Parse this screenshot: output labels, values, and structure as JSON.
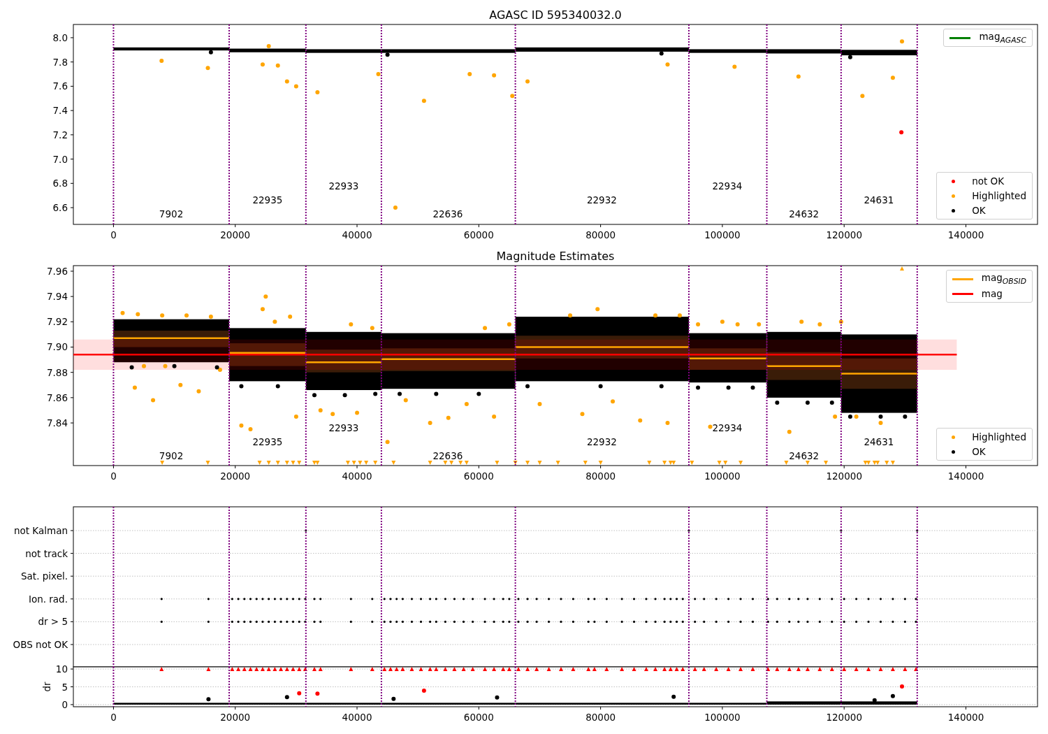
{
  "panels": [
    {
      "chart_data": {
        "type": "scatter",
        "title": "AGASC ID 595340032.0",
        "xlim": [
          -6590,
          151760
        ],
        "ylim": [
          6.462,
          8.109
        ],
        "xticks": [
          0,
          20000,
          40000,
          60000,
          80000,
          100000,
          120000,
          140000
        ],
        "yticks": [
          {
            "value": 6.6,
            "label": "6.6"
          },
          {
            "value": 6.8,
            "label": "6.8"
          },
          {
            "value": 7.0,
            "label": "7.0"
          },
          {
            "value": 7.2,
            "label": "7.2"
          },
          {
            "value": 7.4,
            "label": "7.4"
          },
          {
            "value": 7.6,
            "label": "7.6"
          },
          {
            "value": 7.8,
            "label": "7.8"
          },
          {
            "value": 8.0,
            "label": "8.0"
          }
        ],
        "series": [
          {
            "type": "scatter",
            "color": "#ff0000",
            "x": [
              129400
            ],
            "values": [
              7.22
            ]
          },
          {
            "type": "scatter",
            "color": "#ffa500",
            "x": [
              7900,
              15500,
              24500,
              25500,
              27000,
              28500,
              30000,
              33500,
              43500,
              46300,
              51000,
              58500,
              62500,
              65500,
              68000,
              91000,
              102000,
              112500,
              123000,
              128000,
              129500
            ],
            "values": [
              7.81,
              7.75,
              7.78,
              7.93,
              7.77,
              7.64,
              7.6,
              7.55,
              7.7,
              6.6,
              7.48,
              7.7,
              7.69,
              7.52,
              7.64,
              7.78,
              7.76,
              7.68,
              7.52,
              7.67,
              7.97
            ]
          },
          {
            "type": "scatter",
            "color": "#000000",
            "x": [
              16000,
              45000,
              90000,
              121000
            ],
            "values": [
              7.88,
              7.86,
              7.87,
              7.84
            ]
          }
        ],
        "ref_lines": [
          {
            "axis": "x",
            "value": 0
          },
          {
            "axis": "x",
            "value": 19000
          },
          {
            "axis": "x",
            "value": 31600
          },
          {
            "axis": "x",
            "value": 44000
          },
          {
            "axis": "x",
            "value": 66000
          },
          {
            "axis": "x",
            "value": 94500
          },
          {
            "axis": "x",
            "value": 107300
          },
          {
            "axis": "x",
            "value": 119500
          },
          {
            "axis": "x",
            "value": 132000
          }
        ],
        "annotations": [
          "7902",
          "22935",
          "22933",
          "22636",
          "22932",
          "22934",
          "24632",
          "24631"
        ]
      },
      "legends": [
        {
          "kind": "upper",
          "entries": [
            {
              "label": "mag$_{AGASC}$",
              "color": "#008000",
              "kind": "line"
            }
          ]
        },
        {
          "kind": "lower",
          "entries": [
            {
              "label": "not OK",
              "color": "#ff0000",
              "kind": "marker"
            },
            {
              "label": "Highlighted",
              "color": "#ffa500",
              "kind": "marker"
            },
            {
              "label": "OK",
              "color": "#000000",
              "kind": "marker"
            }
          ]
        }
      ]
    },
    {
      "chart_data": {
        "type": "scatter",
        "title": "Magnitude Estimates",
        "xlim": [
          -6590,
          151760
        ],
        "ylim": [
          7.8063,
          7.9644
        ],
        "xticks": [
          0,
          20000,
          40000,
          60000,
          80000,
          100000,
          120000,
          140000
        ],
        "yticks": [
          {
            "value": 7.84,
            "label": "7.84"
          },
          {
            "value": 7.86,
            "label": "7.86"
          },
          {
            "value": 7.88,
            "label": "7.88"
          },
          {
            "value": 7.9,
            "label": "7.90"
          },
          {
            "value": 7.92,
            "label": "7.92"
          },
          {
            "value": 7.94,
            "label": "7.94"
          },
          {
            "value": 7.96,
            "label": "7.96"
          }
        ],
        "series": [
          {
            "type": "line",
            "color": "#ffa500",
            "x": [
              0,
              19000
            ],
            "values": [
              7.907,
              7.907
            ]
          },
          {
            "type": "line",
            "color": "#ffa500",
            "x": [
              19000,
              31600
            ],
            "values": [
              7.8955,
              7.8955
            ]
          },
          {
            "type": "line",
            "color": "#ffa500",
            "x": [
              31600,
              44000
            ],
            "values": [
              7.888,
              7.888
            ]
          },
          {
            "type": "line",
            "color": "#ffa500",
            "x": [
              44000,
              66000
            ],
            "values": [
              7.8905,
              7.8905
            ]
          },
          {
            "type": "line",
            "color": "#ffa500",
            "x": [
              66000,
              94500
            ],
            "values": [
              7.9,
              7.9
            ]
          },
          {
            "type": "line",
            "color": "#ffa500",
            "x": [
              94500,
              107300
            ],
            "values": [
              7.891,
              7.891
            ]
          },
          {
            "type": "line",
            "color": "#ffa500",
            "x": [
              107300,
              119500
            ],
            "values": [
              7.885,
              7.885
            ]
          },
          {
            "type": "line",
            "color": "#ffa500",
            "x": [
              119500,
              132000
            ],
            "values": [
              7.879,
              7.879
            ]
          },
          {
            "type": "line",
            "color": "#ff0000",
            "x": [
              -6590,
              138500
            ],
            "values": [
              7.894,
              7.894
            ]
          },
          {
            "type": "scatter",
            "color": "#ffa500",
            "x": [
              1500,
              4000,
              8000,
              12000,
              16000,
              5000,
              8500,
              3500,
              6500,
              11000,
              14000,
              17500,
              21000,
              22500,
              25000,
              24500,
              26500,
              29000,
              30000,
              34000,
              36000,
              39000,
              40000,
              42500,
              45000,
              48000,
              52000,
              55000,
              58000,
              61000,
              62500,
              65000,
              70000,
              75000,
              77000,
              79500,
              82000,
              86500,
              89000,
              91000,
              93000,
              96000,
              98000,
              100000,
              102500,
              106000,
              111000,
              113000,
              116000,
              118500,
              119500,
              122000,
              126000
            ],
            "values": [
              7.927,
              7.926,
              7.925,
              7.925,
              7.924,
              7.885,
              7.885,
              7.868,
              7.858,
              7.87,
              7.865,
              7.882,
              7.838,
              7.835,
              7.94,
              7.93,
              7.92,
              7.924,
              7.845,
              7.85,
              7.847,
              7.918,
              7.848,
              7.915,
              7.825,
              7.858,
              7.84,
              7.844,
              7.855,
              7.915,
              7.845,
              7.918,
              7.855,
              7.925,
              7.847,
              7.93,
              7.857,
              7.842,
              7.925,
              7.84,
              7.925,
              7.918,
              7.837,
              7.92,
              7.918,
              7.918,
              7.833,
              7.92,
              7.918,
              7.845,
              7.92,
              7.845,
              7.84
            ]
          },
          {
            "type": "scatter",
            "color": "#000000",
            "x": [
              3000,
              10000,
              17000,
              21000,
              27000,
              33000,
              38000,
              43000,
              47000,
              53000,
              60000,
              68000,
              80000,
              90000,
              96000,
              101000,
              105000,
              109000,
              114000,
              118000,
              121000,
              126000,
              130000
            ],
            "values": [
              7.884,
              7.885,
              7.884,
              7.869,
              7.869,
              7.862,
              7.862,
              7.863,
              7.863,
              7.863,
              7.863,
              7.869,
              7.869,
              7.869,
              7.868,
              7.868,
              7.868,
              7.856,
              7.856,
              7.856,
              7.845,
              7.845,
              7.845
            ]
          }
        ],
        "bands": [
          {
            "axis": "y",
            "from": 7.882,
            "to": 7.906
          }
        ],
        "ref_lines": [
          {
            "axis": "x",
            "value": 0
          },
          {
            "axis": "x",
            "value": 19000
          },
          {
            "axis": "x",
            "value": 31600
          },
          {
            "axis": "x",
            "value": 44000
          },
          {
            "axis": "x",
            "value": 66000
          },
          {
            "axis": "x",
            "value": 94500
          },
          {
            "axis": "x",
            "value": 107300
          },
          {
            "axis": "x",
            "value": 119500
          },
          {
            "axis": "x",
            "value": 132000
          }
        ],
        "annotations": [
          "7902",
          "22935",
          "22933",
          "22636",
          "22932",
          "22934",
          "24632",
          "24631"
        ]
      },
      "legends": [
        {
          "kind": "upper",
          "entries": [
            {
              "label": "mag$_{OBSID}$",
              "color": "#ffa500",
              "kind": "line"
            },
            {
              "label": "mag",
              "color": "#ff0000",
              "kind": "line"
            }
          ]
        },
        {
          "kind": "lower",
          "entries": [
            {
              "label": "Highlighted",
              "color": "#ffa500",
              "kind": "marker"
            },
            {
              "label": "OK",
              "color": "#000000",
              "kind": "marker"
            }
          ]
        }
      ]
    },
    {
      "row_labels": [
        "not Kalman",
        "not track",
        "Sat. pixel.",
        "Ion. rad.",
        "dr > 5",
        "OBS not OK"
      ]
    },
    {
      "chart_data": {
        "type": "scatter",
        "ylabel": "dr",
        "grid": true,
        "xlim": [
          -6590,
          151760
        ],
        "ylim": [
          -0.6,
          10.6
        ],
        "xticks": [
          0,
          20000,
          40000,
          60000,
          80000,
          100000,
          120000,
          140000
        ],
        "yticks": [
          0,
          5,
          10
        ],
        "series": [
          {
            "type": "scatter",
            "color": "#ff0000",
            "x": [
              7900,
              15600,
              19500,
              20500,
              21500,
              22500,
              23500,
              24500,
              25500,
              26500,
              27500,
              28500,
              29500,
              30500,
              31500,
              33000,
              34000,
              39000,
              42500,
              44500,
              45500,
              46500,
              47500,
              49000,
              50500,
              52000,
              53000,
              54500,
              56000,
              57500,
              59000,
              61000,
              62500,
              64000,
              65000,
              66500,
              68000,
              69500,
              71500,
              73500,
              75500,
              78000,
              79000,
              81000,
              83500,
              85500,
              87500,
              89000,
              90500,
              91500,
              92500,
              93500,
              95500,
              97000,
              99000,
              101000,
              103000,
              105000,
              107500,
              109000,
              111000,
              112500,
              114000,
              116000,
              118000,
              120000,
              122000,
              124000,
              126000,
              128000,
              130000,
              131800
            ],
            "values": [
              10,
              10,
              10,
              10,
              10,
              10,
              10,
              10,
              10,
              10,
              10,
              10,
              10,
              10,
              10,
              10,
              10,
              10,
              10,
              10,
              10,
              10,
              10,
              10,
              10,
              10,
              10,
              10,
              10,
              10,
              10,
              10,
              10,
              10,
              10,
              10,
              10,
              10,
              10,
              10,
              10,
              10,
              10,
              10,
              10,
              10,
              10,
              10,
              10,
              10,
              10,
              10,
              10,
              10,
              10,
              10,
              10,
              10,
              10,
              10,
              10,
              10,
              10,
              10,
              10,
              10,
              10,
              10,
              10,
              10,
              10,
              10
            ]
          },
          {
            "type": "scatter",
            "color": "#ff0000",
            "x": [
              30500,
              33500,
              51000,
              129500
            ],
            "values": [
              3.2,
              3.1,
              3.9,
              5.1
            ]
          },
          {
            "type": "scatter",
            "color": "#000000",
            "x": [
              15600,
              28500,
              46000,
              63000,
              92000,
              125000,
              128000
            ],
            "values": [
              1.5,
              2.1,
              1.6,
              2,
              2.2,
              1.2,
              2.4
            ]
          }
        ],
        "ref_lines": [
          {
            "axis": "x",
            "value": 0
          },
          {
            "axis": "x",
            "value": 19000
          },
          {
            "axis": "x",
            "value": 31600
          },
          {
            "axis": "x",
            "value": 44000
          },
          {
            "axis": "x",
            "value": 66000
          },
          {
            "axis": "x",
            "value": 94500
          },
          {
            "axis": "x",
            "value": 107300
          },
          {
            "axis": "x",
            "value": 119500
          },
          {
            "axis": "x",
            "value": 132000
          }
        ]
      }
    }
  ]
}
